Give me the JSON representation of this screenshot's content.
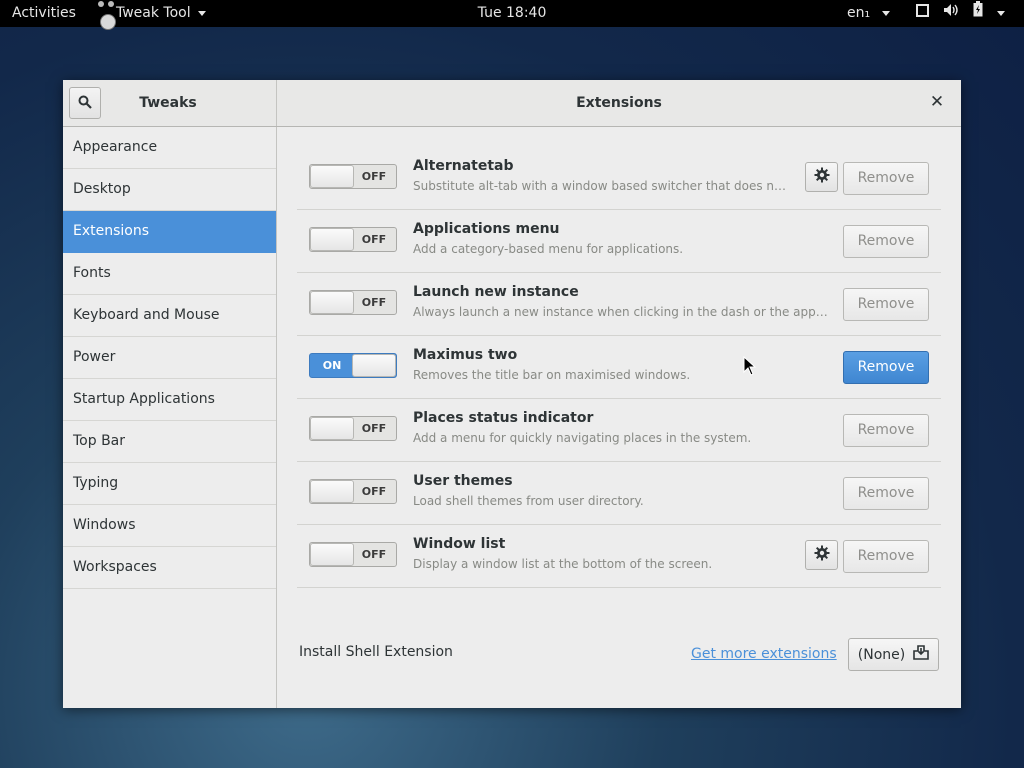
{
  "topbar": {
    "activities": "Activities",
    "app_name": "Tweak Tool",
    "clock": "Tue 18:40",
    "lang": "en₁"
  },
  "window": {
    "sidebar_title": "Tweaks",
    "title": "Extensions"
  },
  "sidebar": {
    "items": [
      {
        "label": "Appearance"
      },
      {
        "label": "Desktop"
      },
      {
        "label": "Extensions"
      },
      {
        "label": "Fonts"
      },
      {
        "label": "Keyboard and Mouse"
      },
      {
        "label": "Power"
      },
      {
        "label": "Startup Applications"
      },
      {
        "label": "Top Bar"
      },
      {
        "label": "Typing"
      },
      {
        "label": "Windows"
      },
      {
        "label": "Workspaces"
      }
    ],
    "selected": "Extensions"
  },
  "switch_labels": {
    "on": "ON",
    "off": "OFF"
  },
  "extensions": [
    {
      "name": "Alternatetab",
      "description": "Substitute alt-tab with a window based switcher that does not gro...",
      "enabled": false,
      "has_settings": true,
      "remove_label": "Remove"
    },
    {
      "name": "Applications menu",
      "description": "Add a category-based menu for applications.",
      "enabled": false,
      "has_settings": false,
      "remove_label": "Remove"
    },
    {
      "name": "Launch new instance",
      "description": "Always launch a new instance when clicking in the dash or the application ...",
      "enabled": false,
      "has_settings": false,
      "remove_label": "Remove"
    },
    {
      "name": "Maximus two",
      "description": "Removes the title bar on maximised windows.",
      "enabled": true,
      "has_settings": false,
      "remove_label": "Remove"
    },
    {
      "name": "Places status indicator",
      "description": "Add a menu for quickly navigating places in the system.",
      "enabled": false,
      "has_settings": false,
      "remove_label": "Remove"
    },
    {
      "name": "User themes",
      "description": "Load shell themes from user directory.",
      "enabled": false,
      "has_settings": false,
      "remove_label": "Remove"
    },
    {
      "name": "Window list",
      "description": "Display a window list at the bottom of the screen.",
      "enabled": false,
      "has_settings": true,
      "remove_label": "Remove"
    }
  ],
  "install": {
    "label": "Install Shell Extension",
    "more_link": "Get more extensions",
    "file_chooser": "(None)"
  },
  "colors": {
    "accent": "#4a90d9",
    "topbar": "#000000",
    "window_bg": "#ededed"
  },
  "icons": {
    "search": "search-icon",
    "close": "close-icon",
    "gear": "gear-icon",
    "file": "document-open-icon",
    "screen": "display-icon",
    "volume": "volume-icon",
    "battery": "battery-icon",
    "menu": "chevron-down-icon"
  }
}
